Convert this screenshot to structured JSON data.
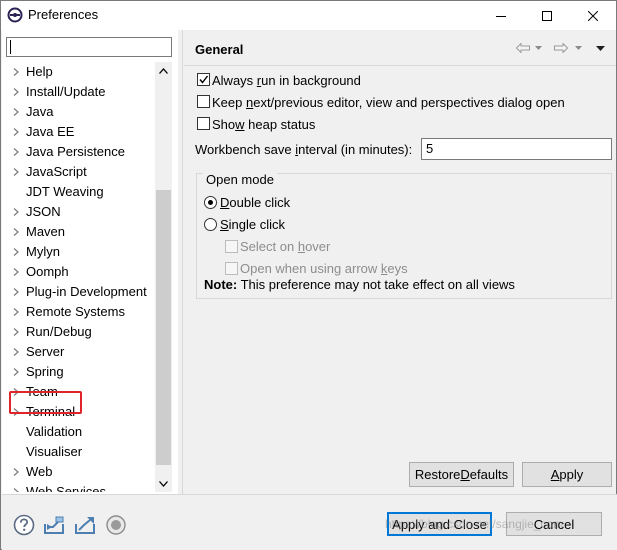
{
  "window": {
    "title": "Preferences"
  },
  "filter": {
    "value": ""
  },
  "tree": {
    "items": [
      {
        "label": "Help",
        "expandable": true
      },
      {
        "label": "Install/Update",
        "expandable": true
      },
      {
        "label": "Java",
        "expandable": true
      },
      {
        "label": "Java EE",
        "expandable": true
      },
      {
        "label": "Java Persistence",
        "expandable": true
      },
      {
        "label": "JavaScript",
        "expandable": true
      },
      {
        "label": "JDT Weaving",
        "expandable": false
      },
      {
        "label": "JSON",
        "expandable": true
      },
      {
        "label": "Maven",
        "expandable": true
      },
      {
        "label": "Mylyn",
        "expandable": true
      },
      {
        "label": "Oomph",
        "expandable": true
      },
      {
        "label": "Plug-in Development",
        "expandable": true
      },
      {
        "label": "Remote Systems",
        "expandable": true
      },
      {
        "label": "Run/Debug",
        "expandable": true
      },
      {
        "label": "Server",
        "expandable": true
      },
      {
        "label": "Spring",
        "expandable": true,
        "highlighted": true
      },
      {
        "label": "Team",
        "expandable": true
      },
      {
        "label": "Terminal",
        "expandable": true
      },
      {
        "label": "Validation",
        "expandable": false
      },
      {
        "label": "Visualiser",
        "expandable": false
      },
      {
        "label": "Web",
        "expandable": true
      },
      {
        "label": "Web Services",
        "expandable": true
      }
    ],
    "highlight_color": "#e0242a"
  },
  "page": {
    "title": "General",
    "always_run_background": {
      "pre": "Always ",
      "ul": "r",
      "post": "un in background",
      "checked": true
    },
    "keep_next_prev": {
      "pre": "Keep ",
      "ul": "n",
      "post": "ext/previous editor, view and perspectives dialog open",
      "checked": false
    },
    "show_heap": {
      "pre": "Sho",
      "ul": "w",
      "post": " heap status",
      "checked": false
    },
    "save_interval": {
      "pre": "Workbench save ",
      "ul": "i",
      "post": "nterval (in minutes):",
      "value": "5"
    },
    "open_mode": {
      "legend": "Open mode",
      "double_click": {
        "pre": "",
        "ul": "D",
        "post": "ouble click",
        "selected": true
      },
      "single_click": {
        "pre": "",
        "ul": "S",
        "post": "ingle click",
        "selected": false
      },
      "select_on_hover": {
        "pre": "Select on ",
        "ul": "h",
        "post": "over",
        "checked": false,
        "enabled": false
      },
      "open_arrow_keys": {
        "pre": "Open when using arrow ",
        "ul": "k",
        "post": "eys",
        "checked": false,
        "enabled": false
      },
      "note_bold": "Note:",
      "note_text": " This preference may not take effect on all views"
    },
    "restore_defaults": {
      "pre": "Restore ",
      "ul": "D",
      "post": "efaults"
    },
    "apply": {
      "pre": "",
      "ul": "A",
      "post": "pply"
    }
  },
  "bottom": {
    "icons": [
      "help-icon",
      "import-icon",
      "export-icon",
      "record-icon"
    ],
    "apply_close": "Apply and Close",
    "cancel": "Cancel",
    "watermark": "https://blog.csdn.net/sangjie_com"
  }
}
